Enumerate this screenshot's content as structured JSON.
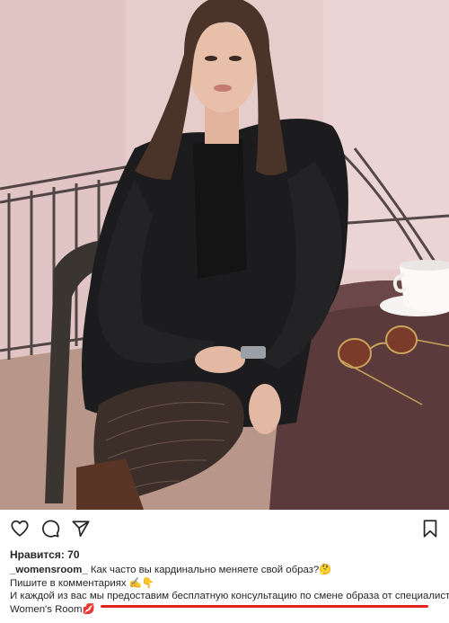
{
  "post": {
    "likes_text": "Нравится: 70",
    "username": "_womensroom_",
    "caption_line1": "Как часто вы кардинально меняете свой образ?🤔",
    "caption_line2": "Пишите в комментариях ✍️👇",
    "caption_line3": "И каждой из вас мы предоставим бесплатную консультацию по смене образа от специалистов",
    "caption_line4": "Women's Room💋"
  },
  "actions": {
    "like_icon": "heart-icon",
    "comment_icon": "comment-icon",
    "share_icon": "paper-plane-icon",
    "save_icon": "bookmark-icon"
  },
  "colors": {
    "underline": "#e2231a",
    "text": "#262626"
  }
}
